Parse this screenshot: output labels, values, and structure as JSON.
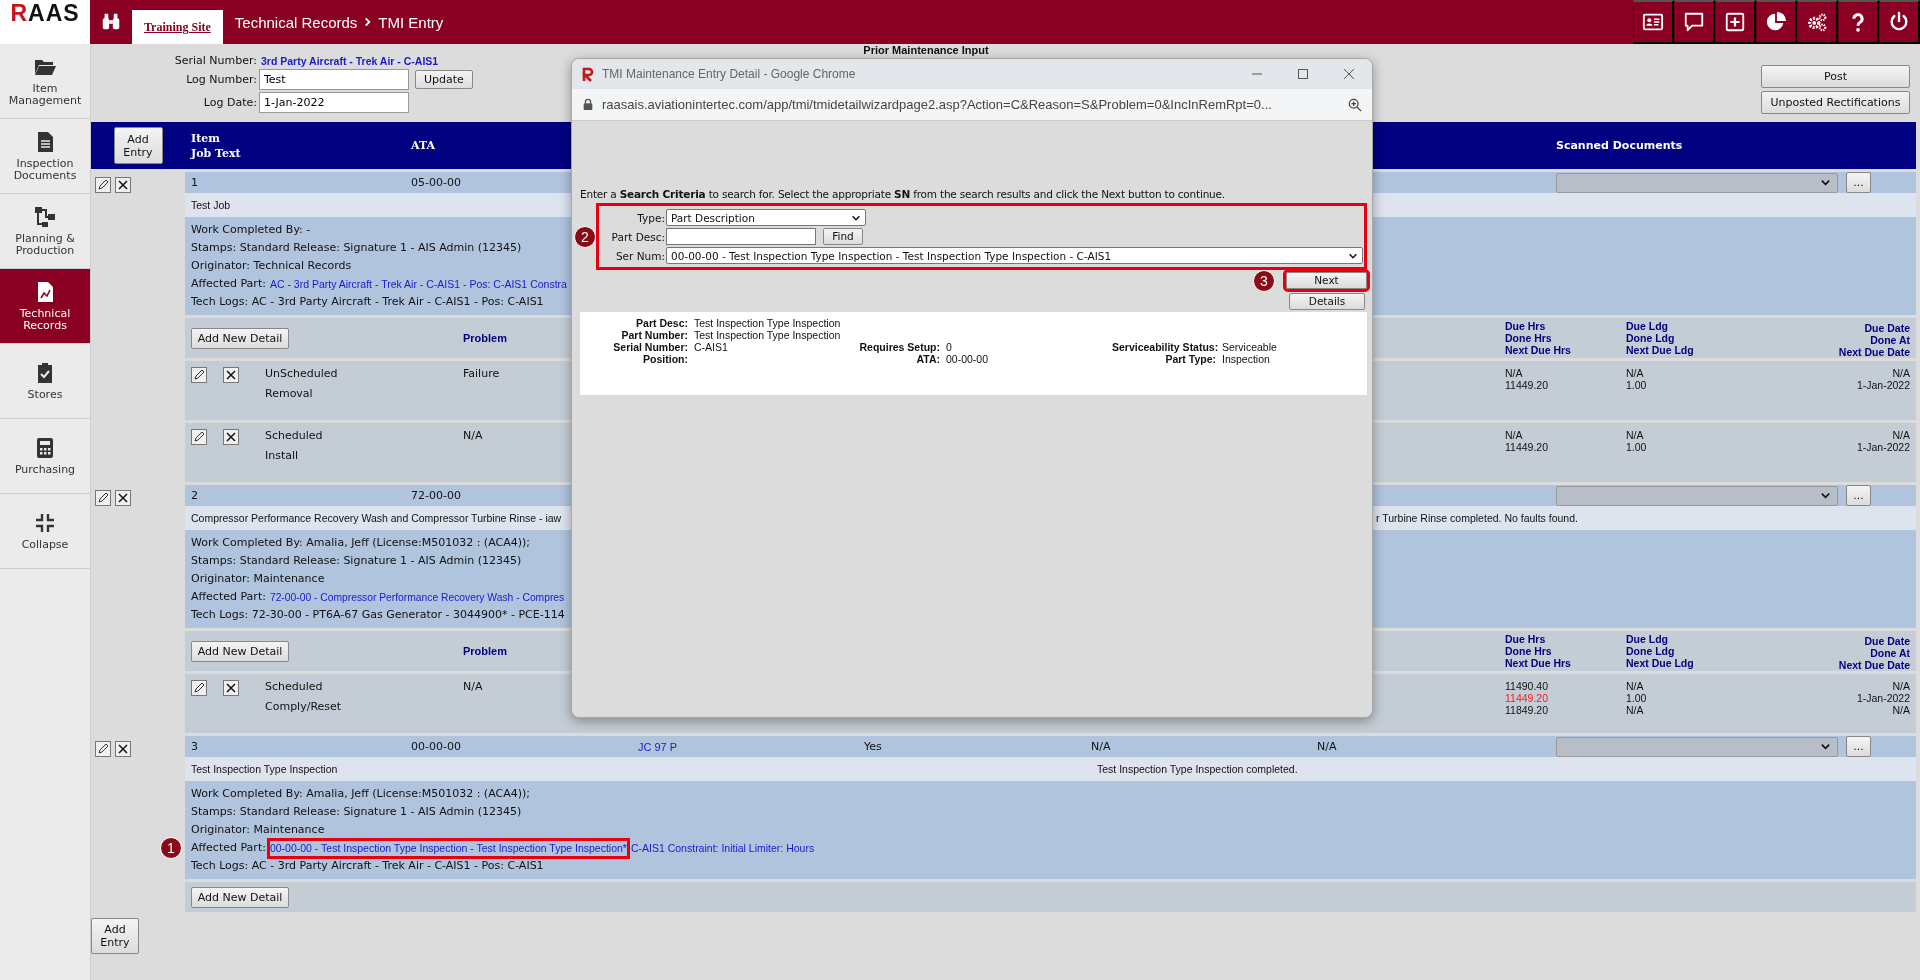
{
  "app": {
    "logo": "RAAS",
    "site_tab": {
      "label": "Training Site",
      "selected": true
    },
    "breadcrumb": [
      "Technical Records",
      "TMI Entry"
    ]
  },
  "sidebar": [
    {
      "label": "Item Management",
      "selected": false
    },
    {
      "label": "Inspection Documents",
      "selected": false
    },
    {
      "label": "Planning & Production",
      "selected": false
    },
    {
      "label": "Technical Records",
      "selected": true
    },
    {
      "label": "Stores",
      "selected": false
    },
    {
      "label": "Purchasing",
      "selected": false
    },
    {
      "label": "Collapse",
      "selected": false
    }
  ],
  "form": {
    "serial_number": {
      "label": "Serial Number:",
      "value": "3rd Party Aircraft - Trek Air - C-AIS1"
    },
    "log_number": {
      "label": "Log Number:",
      "value": "Test"
    },
    "update_button": "Update",
    "log_date": {
      "label": "Log Date:",
      "value": "1-Jan-2022"
    }
  },
  "page_title": "Prior Maintenance Input",
  "actions": [
    "Post",
    "Unposted Rectifications"
  ],
  "table": {
    "add_entry": "Add Entry",
    "columns": [
      {
        "lines": [
          "Item",
          "Job Text"
        ]
      },
      {
        "lines": [
          "ATA"
        ]
      }
    ],
    "scanned_documents_heading": "Scanned Documents",
    "entries": [
      {
        "cells": [
          {
            "kind": "text",
            "text": "1"
          },
          {
            "kind": "text",
            "text": "05-00-00"
          }
        ],
        "browse_button": "...",
        "job_text": "Test Job",
        "details": [
          {
            "kind": "text",
            "text": "Work Completed By: -"
          },
          {
            "kind": "text",
            "text": "Stamps: Standard Release: Signature 1 - AIS Admin (12345)"
          },
          {
            "kind": "text",
            "text": "Originator: Technical Records"
          },
          {
            "kind": "part",
            "label": "Affected Part:",
            "links": [
              {
                "text": "AC - 3rd Party Aircraft - Trek Air - C-AIS1 - Pos: C-AIS1 Constra",
                "highlighted": false
              }
            ]
          },
          {
            "kind": "text",
            "text": "Tech Logs: AC - 3rd Party Aircraft - Trek Air - C-AIS1 - Pos: C-AIS1"
          }
        ],
        "add_detail": "Add New Detail",
        "problem_heading": "Problem",
        "due_headings": [
          [
            "Due Hrs",
            "Done Hrs",
            "Next Due Hrs"
          ],
          [
            "Due Ldg",
            "Done Ldg",
            "Next Due Ldg"
          ],
          [
            "Due Date",
            "Done At",
            "Next Due Date"
          ]
        ],
        "detail_rows": [
          {
            "type": [
              "UnScheduled",
              "Removal"
            ],
            "problem": "Failure",
            "hrs": [
              {
                "text": "N/A",
                "alert": false
              },
              {
                "text": "11449.20",
                "alert": false
              }
            ],
            "ldg": [
              {
                "text": "N/A",
                "alert": false
              },
              {
                "text": "1.00",
                "alert": false
              }
            ],
            "date": [
              {
                "text": "N/A",
                "alert": false
              },
              {
                "text": "1-Jan-2022",
                "alert": false
              }
            ]
          },
          {
            "type": [
              "Scheduled",
              "Install"
            ],
            "problem": "N/A",
            "hrs": [
              {
                "text": "N/A",
                "alert": false
              },
              {
                "text": "11449.20",
                "alert": false
              }
            ],
            "ldg": [
              {
                "text": "N/A",
                "alert": false
              },
              {
                "text": "1.00",
                "alert": false
              }
            ],
            "date": [
              {
                "text": "N/A",
                "alert": false
              },
              {
                "text": "1-Jan-2022",
                "alert": false
              }
            ]
          }
        ]
      },
      {
        "cells": [
          {
            "kind": "text",
            "text": "2"
          },
          {
            "kind": "text",
            "text": "72-00-00"
          }
        ],
        "browse_button": "...",
        "job_text": "Compressor Performance Recovery Wash and Compressor Turbine Rinse - iaw",
        "result": "r Turbine Rinse completed. No faults found.",
        "details": [
          {
            "kind": "text",
            "text": "Work Completed By: Amalia, Jeff (License:M501032 : (ACA4));"
          },
          {
            "kind": "text",
            "text": "Stamps: Standard Release: Signature 1 - AIS Admin (12345)"
          },
          {
            "kind": "text",
            "text": "Originator: Maintenance"
          },
          {
            "kind": "part",
            "label": "Affected Part:",
            "links": [
              {
                "text": "72-00-00 - Compressor Performance Recovery Wash - Compres",
                "highlighted": false
              }
            ]
          },
          {
            "kind": "text",
            "text": "Tech Logs: 72-30-00 - PT6A-67 Gas Generator - 3044900* - PCE-114"
          }
        ],
        "add_detail": "Add New Detail",
        "problem_heading": "Problem",
        "due_headings": [
          [
            "Due Hrs",
            "Done Hrs",
            "Next Due Hrs"
          ],
          [
            "Due Ldg",
            "Done Ldg",
            "Next Due Ldg"
          ],
          [
            "Due Date",
            "Done At",
            "Next Due Date"
          ]
        ],
        "detail_rows": [
          {
            "type": [
              "Scheduled",
              "Comply/Reset"
            ],
            "problem": "N/A",
            "hrs": [
              {
                "text": "11490.40",
                "alert": false
              },
              {
                "text": "11449.20",
                "alert": true
              },
              {
                "text": "11849.20",
                "alert": false
              }
            ],
            "ldg": [
              {
                "text": "N/A",
                "alert": false
              },
              {
                "text": "1.00",
                "alert": false
              },
              {
                "text": "N/A",
                "alert": false
              }
            ],
            "date": [
              {
                "text": "N/A",
                "alert": false
              },
              {
                "text": "1-Jan-2022",
                "alert": false
              },
              {
                "text": "N/A",
                "alert": false
              }
            ]
          }
        ]
      },
      {
        "cells": [
          {
            "kind": "text",
            "text": "3"
          },
          {
            "kind": "text",
            "text": "00-00-00"
          },
          {
            "kind": "link",
            "text": "JC 97 P"
          },
          {
            "kind": "text",
            "text": "Yes"
          },
          {
            "kind": "text",
            "text": "N/A"
          },
          {
            "kind": "text",
            "text": "N/A"
          }
        ],
        "browse_button": "...",
        "job_text": "Test Inspection Type Inspection",
        "result": "Test Inspection Type Inspection completed.",
        "details": [
          {
            "kind": "text",
            "text": "Work Completed By: Amalia, Jeff (License:M501032 : (ACA4));"
          },
          {
            "kind": "text",
            "text": "Stamps: Standard Release: Signature 1 - AIS Admin (12345)"
          },
          {
            "kind": "text",
            "text": "Originator: Maintenance"
          },
          {
            "kind": "part",
            "label": "Affected Part:",
            "callout": "1",
            "links": [
              {
                "text": "00-00-00 - Test Inspection Type Inspection - Test Inspection Type Inspection*",
                "highlighted": true
              },
              {
                "text": "C-AIS1 Constraint: Initial Limiter: Hours",
                "highlighted": false
              }
            ]
          },
          {
            "kind": "text",
            "text": "Tech Logs: AC - 3rd Party Aircraft - Trek Air - C-AIS1 - Pos: C-AIS1"
          }
        ],
        "add_detail": "Add New Detail"
      }
    ],
    "add_entry_bottom": "Add Entry"
  },
  "popup": {
    "title": "TMI Maintenance Entry Detail - Google Chrome",
    "url": "raasais.aviationintertec.com/app/tmi/tmidetailwizardpage2.asp?Action=C&Reason=S&Problem=0&IncInRemRpt=0...",
    "instruction": "Enter a **Search Criteria** to search for. Select the appropriate **SN** from the search results and click the Next button to continue.",
    "search": {
      "highlighted": true,
      "callout": "2",
      "type": {
        "label": "Type:",
        "value": "Part Description"
      },
      "part_desc": {
        "label": "Part Desc:"
      },
      "find_button": "Find",
      "ser_num": {
        "label": "Ser Num:",
        "value": "00-00-00 - Test Inspection Type Inspection - Test Inspection Type Inspection - C-AIS1"
      }
    },
    "buttons": [
      {
        "label": "Next",
        "highlighted": true,
        "callout": "3"
      },
      {
        "label": "Details",
        "highlighted": false
      }
    ],
    "details": [
      [
        {
          "label": "Part Desc:",
          "value": "Test Inspection Type Inspection"
        }
      ],
      [
        {
          "label": "Part Number:",
          "value": "Test Inspection Type Inspection"
        }
      ],
      [
        {
          "label": "Serial Number:",
          "value": "C-AIS1"
        },
        {
          "label": "Requires Setup:",
          "value": "0"
        },
        {
          "label": "Serviceability Status:",
          "value": "Serviceable"
        }
      ],
      [
        {
          "label": "Position:"
        },
        {
          "label": "ATA:",
          "value": "00-00-00"
        },
        {
          "label": "Part Type:",
          "value": "Inspection"
        }
      ]
    ]
  }
}
